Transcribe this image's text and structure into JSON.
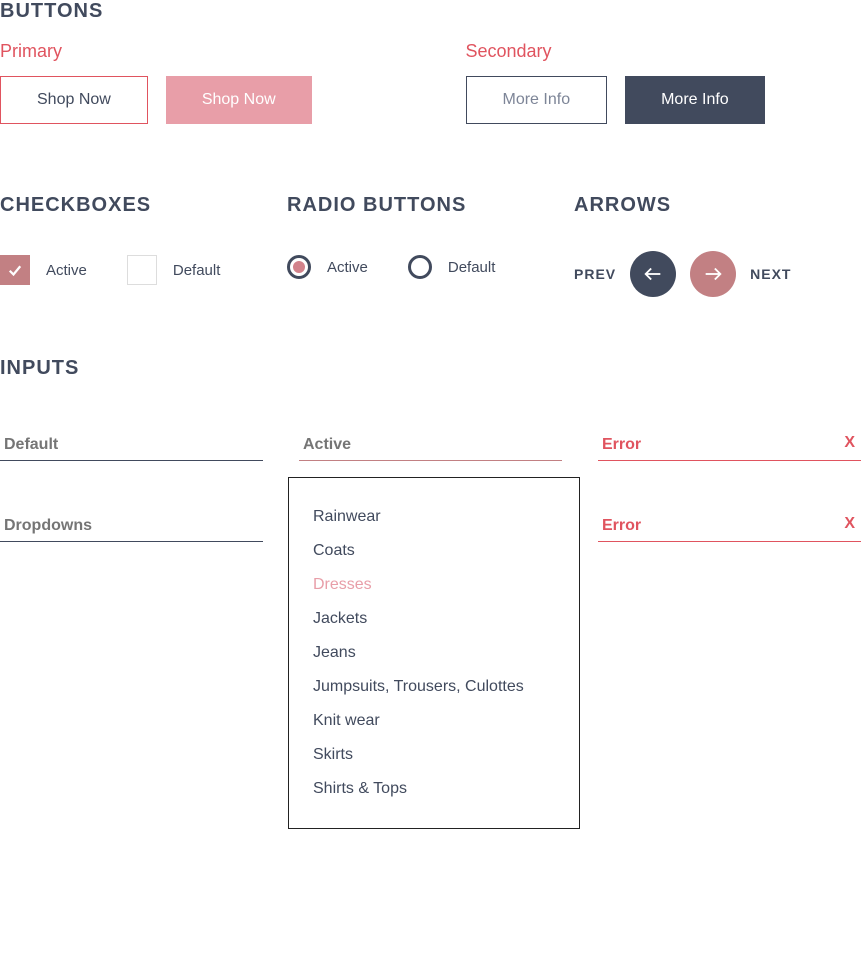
{
  "sections": {
    "buttons": "BUTTONS",
    "primary": "Primary",
    "secondary": "Secondary",
    "checkboxes": "CHECKBOXES",
    "radio_buttons": "RADIO BUTTONS",
    "arrows": "ARROWS",
    "inputs": "INPUTS"
  },
  "buttons": {
    "primary_outline": "Shop Now",
    "primary_fill": "Shop Now",
    "secondary_outline": "More Info",
    "secondary_fill": "More Info"
  },
  "checkboxes": {
    "active": "Active",
    "default": "Default"
  },
  "radios": {
    "active": "Active",
    "default": "Default"
  },
  "arrows": {
    "prev": "PREV",
    "next": "NEXT"
  },
  "inputs": {
    "default_ph": "Default",
    "active_ph": "Active",
    "error_ph": "Error",
    "dropdown_ph": "Dropdowns",
    "error_x": "X"
  },
  "dropdown": {
    "options": [
      "Rainwear",
      "Coats",
      "Dresses",
      "Jackets",
      "Jeans",
      "Jumpsuits, Trousers, Culottes",
      "Knit wear",
      "Skirts",
      "Shirts & Tops"
    ],
    "selected_index": 2
  },
  "colors": {
    "accent": "#e0545f",
    "accent_light": "#e89ea8",
    "accent_mid": "#c28083",
    "dark": "#414a5d"
  }
}
